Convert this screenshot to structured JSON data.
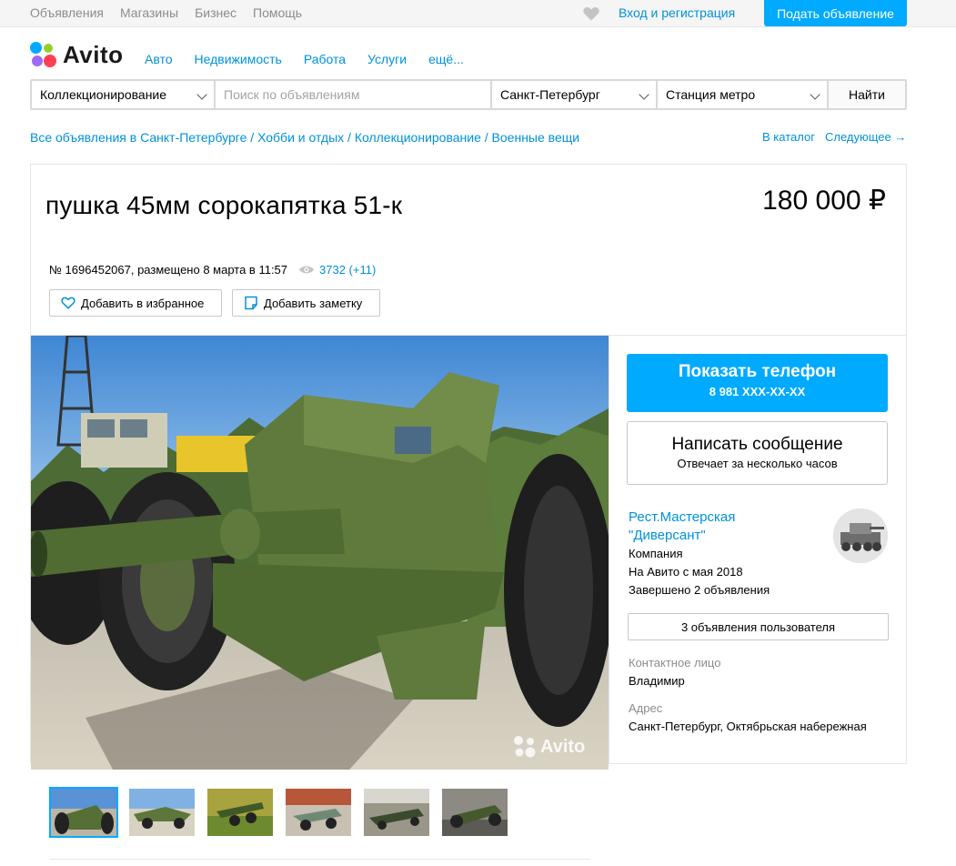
{
  "topbar": {
    "nav": [
      "Объявления",
      "Магазины",
      "Бизнес",
      "Помощь"
    ],
    "login": "Вход и регистрация",
    "post_ad": "Подать объявление"
  },
  "header": {
    "logo_text": "Avito",
    "nav": [
      "Авто",
      "Недвижимость",
      "Работа",
      "Услуги",
      "ещё..."
    ]
  },
  "search": {
    "category": "Коллекционирование",
    "placeholder": "Поиск по объявлениям",
    "city": "Санкт-Петербург",
    "metro": "Станция метро",
    "button": "Найти"
  },
  "breadcrumb": {
    "items": [
      "Все объявления в Санкт-Петербурге",
      "Хобби и отдых",
      "Коллекционирование",
      "Военные вещи"
    ],
    "catalog": "В каталог",
    "next": "Следующее →"
  },
  "listing": {
    "title": "пушка 45мм сорокапятка  51-к",
    "price": "180 000 ₽",
    "meta": "№ 1696452067, размещено 8 марта в 11:57",
    "views": "3732 (+11)",
    "favorite": "Добавить в избранное",
    "note": "Добавить заметку",
    "watermark": "Avito"
  },
  "contact": {
    "phone_title": "Показать телефон",
    "phone_masked": "8 981 XXX-XX-XX",
    "message_title": "Написать сообщение",
    "message_sub": "Отвечает за несколько часов"
  },
  "seller": {
    "name_line1": "Рест.Мастерская",
    "name_line2": "\"Диверсант\"",
    "type": "Компания",
    "since": "На Авито с мая 2018",
    "completed": "Завершено 2 объявления",
    "listings_button": "3 объявления пользователя",
    "contact_label": "Контактное лицо",
    "contact_name": "Владимир",
    "address_label": "Адрес",
    "address": "Санкт-Петербург, Октябрьская набережная"
  },
  "colors": {
    "accent": "#00aaff",
    "link": "#0091d9"
  }
}
